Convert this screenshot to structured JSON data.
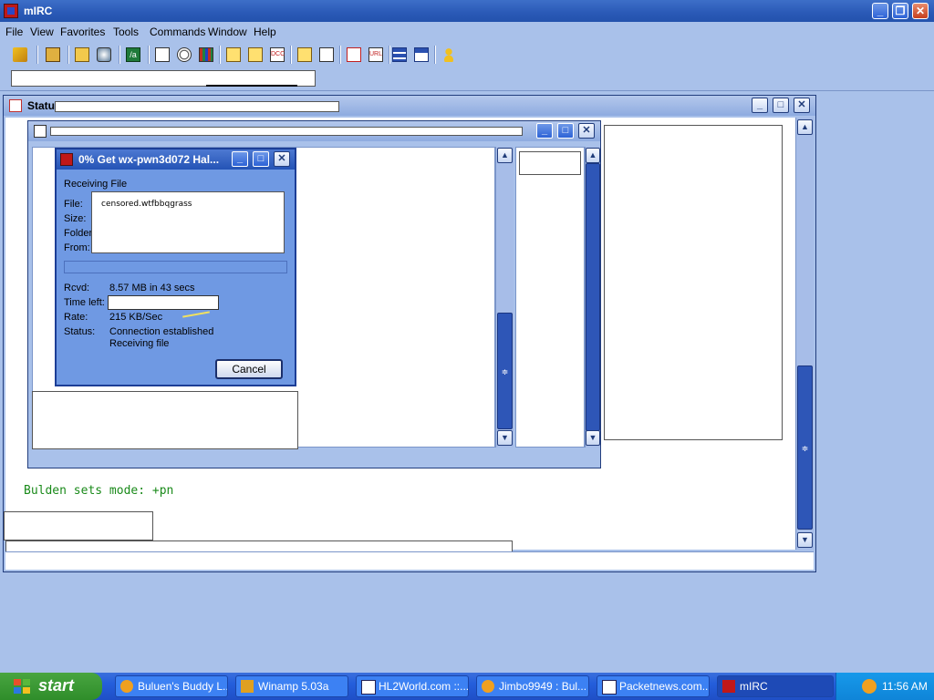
{
  "app": {
    "title": "mIRC"
  },
  "menubar": {
    "items": [
      "File",
      "View",
      "Favorites",
      "Tools",
      "Commands",
      "Window",
      "Help"
    ]
  },
  "toolbar_icons": [
    "connect-icon",
    "options-icon",
    "channels-folder-icon",
    "server-icon",
    "scripts-editor-icon",
    "address-book-icon",
    "timer-icon",
    "colors-icon",
    "send-file-icon",
    "chat-icon",
    "dcc-icon",
    "notify-icon",
    "urls-icon",
    "text-icon",
    "tile-icon",
    "cascade-icon",
    "user-icon"
  ],
  "status_window": {
    "title": "Statu"
  },
  "status_lines": {
    "line1": "Bulden sets mode: +pn"
  },
  "dcc_dialog": {
    "title": "0% Get wx-pwn3d072 Hal...",
    "heading": "Receiving File",
    "labels": {
      "file": "File:",
      "size": "Size:",
      "folder": "Folder:",
      "from": "From:",
      "rcvd": "Rcvd:",
      "time_left": "Time left:",
      "rate": "Rate:",
      "status": "Status:"
    },
    "values": {
      "file": "censored.wtfbbqgrass",
      "rcvd": "8.57 MB in 43 secs",
      "rate": "215 KB/Sec",
      "status_line1": "Connection established",
      "status_line2": "Receiving file"
    },
    "progress_percent": 0,
    "cancel_label": "Cancel"
  },
  "taskbar": {
    "start_label": "start",
    "tasks": [
      "Buluen's Buddy L...",
      "Winamp 5.03a",
      "HL2World.com ::...",
      "Jimbo9949 : Bul...",
      "Packetnews.com...",
      "mIRC"
    ],
    "clock": "11:56 AM"
  },
  "colors": {
    "accent": "#2453b5",
    "background": "#a9c1ea",
    "taskbar": "#245edb",
    "start_button": "#3c9a34",
    "irc_text_green": "#1a8a1a"
  }
}
